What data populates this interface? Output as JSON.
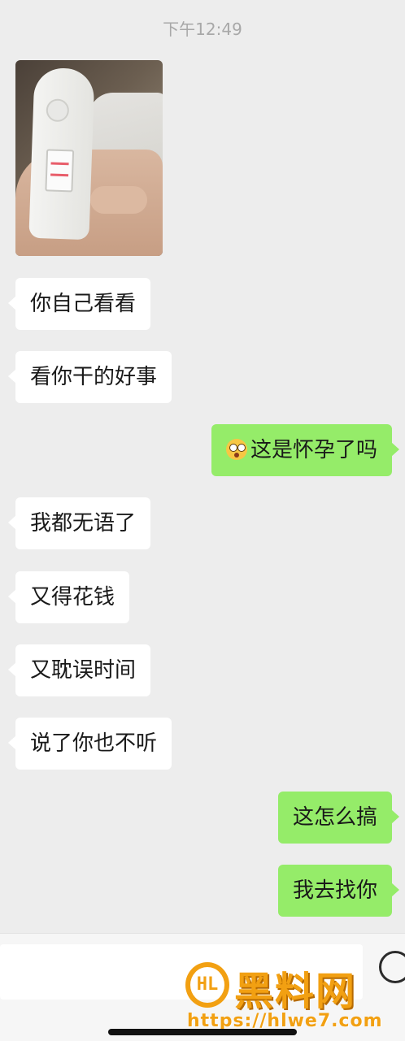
{
  "status": {
    "time": "下午12:49"
  },
  "messages": [
    {
      "side": "left",
      "type": "image",
      "description": "pregnancy-test-photo"
    },
    {
      "side": "left",
      "type": "text",
      "text": "你自己看看"
    },
    {
      "side": "left",
      "type": "text",
      "text": "看你干的好事"
    },
    {
      "side": "right",
      "type": "text",
      "text": "这是怀孕了吗",
      "emoji": "flushed-face"
    },
    {
      "side": "left",
      "type": "text",
      "text": "我都无语了"
    },
    {
      "side": "left",
      "type": "text",
      "text": "又得花钱"
    },
    {
      "side": "left",
      "type": "text",
      "text": "又耽误时间"
    },
    {
      "side": "left",
      "type": "text",
      "text": "说了你也不听"
    },
    {
      "side": "right",
      "type": "text",
      "text": "这怎么搞"
    },
    {
      "side": "right",
      "type": "text",
      "text": "我去找你"
    }
  ],
  "watermark": {
    "title": "黑料网",
    "url": "https://hlwe7.com",
    "logo_text": "HL"
  },
  "colors": {
    "background": "#ededed",
    "sent_bubble": "#95ec69",
    "received_bubble": "#ffffff",
    "watermark": "#f2a012"
  }
}
